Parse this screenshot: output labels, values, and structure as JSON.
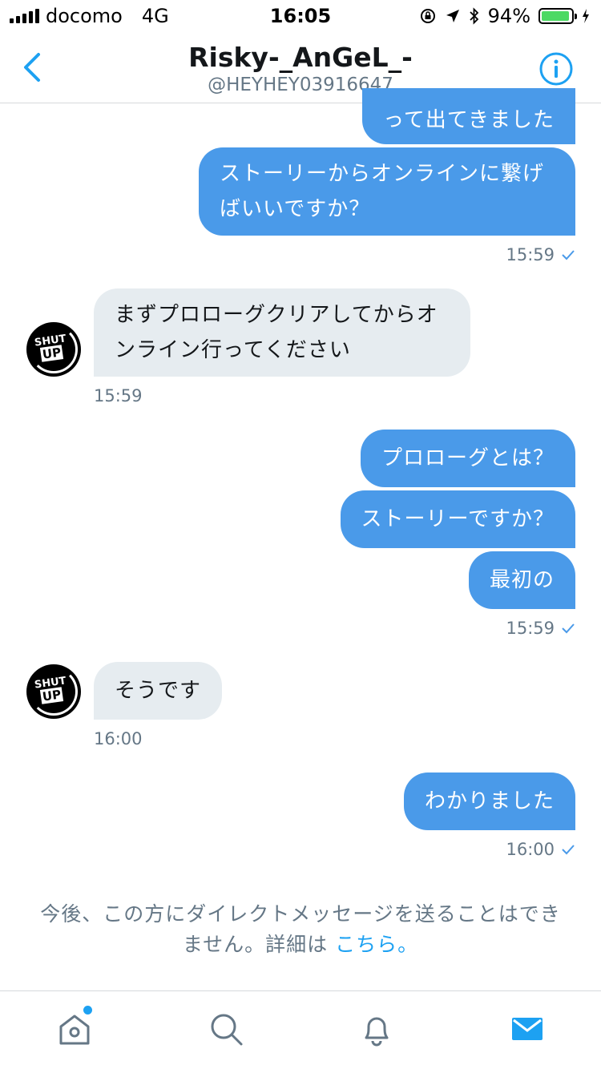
{
  "status_bar": {
    "carrier": "docomo",
    "network": "4G",
    "time": "16:05",
    "battery_percent": "94%",
    "battery_level": 0.94
  },
  "header": {
    "title": "Risky-_AnGeL_-",
    "handle": "@HEYHEY03916647"
  },
  "messages": [
    {
      "text": "って出てきました"
    },
    {
      "text": "ストーリーからオンラインに繋げ\nばいいですか？",
      "time": "15:59"
    },
    {
      "text": "まずプロローグクリアしてからオ\nンライン行ってください",
      "time": "15:59"
    },
    {
      "text": "プロローグとは？"
    },
    {
      "text": "ストーリーですか？"
    },
    {
      "text": "最初の",
      "time": "15:59"
    },
    {
      "text": "そうです",
      "time": "16:00"
    },
    {
      "text": "わかりました",
      "time": "16:00"
    }
  ],
  "notice": {
    "line1": "今後、この方にダイレクトメッセージを送ることはでき",
    "line2": "ません。詳細は",
    "link": "こちら。"
  },
  "colors": {
    "sent_bubble": "#4a9ae9",
    "received_bubble": "#e6ecf0",
    "accent": "#1da1f2"
  },
  "tabs": [
    "home-icon",
    "search-icon",
    "notifications-icon",
    "messages-icon"
  ]
}
